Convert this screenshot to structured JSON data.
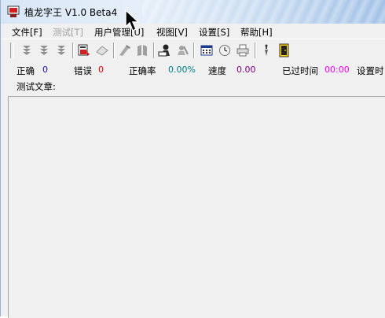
{
  "window": {
    "title": "植龙字王 V1.0 Beta4"
  },
  "menu": [
    {
      "label": "文件[F]",
      "enabled": true
    },
    {
      "label": "测试[T]",
      "enabled": false
    },
    {
      "label": "用户管理[U]",
      "enabled": true
    },
    {
      "label": "视图[V]",
      "enabled": true
    },
    {
      "label": "设置[S]",
      "enabled": true
    },
    {
      "label": "帮助[H]",
      "enabled": true
    }
  ],
  "toolbar": {
    "buttons": [
      {
        "icon": "stack-down-icon",
        "enabled": false
      },
      {
        "icon": "stack-down-icon-2",
        "enabled": false
      },
      {
        "icon": "stack-down-icon-3",
        "enabled": false
      },
      {
        "icon": "red-document-icon",
        "enabled": true
      },
      {
        "icon": "eraser-icon",
        "enabled": false
      },
      {
        "icon": "gray-tool-icon",
        "enabled": false
      },
      {
        "icon": "gray-book-icon",
        "enabled": false
      },
      {
        "icon": "user-keyboard-icon",
        "enabled": true
      },
      {
        "icon": "gray-user-icon",
        "enabled": false
      },
      {
        "icon": "calculator-icon",
        "enabled": true
      },
      {
        "icon": "clock-icon",
        "enabled": true
      },
      {
        "icon": "printer-icon",
        "enabled": true
      },
      {
        "icon": "tools-icon",
        "enabled": true
      },
      {
        "icon": "exit-door-icon",
        "enabled": true
      }
    ]
  },
  "stats": {
    "correct_label": "正确",
    "correct_value": "0",
    "error_label": "错误",
    "error_value": "0",
    "accuracy_label": "正确率",
    "accuracy_value": "0.00%",
    "speed_label": "速度",
    "speed_value": "0.00",
    "elapsed_label": "已过时间",
    "elapsed_value": "00:00",
    "set_time_label": "设置时"
  },
  "article": {
    "label": "测试文章:"
  },
  "colors": {
    "correct_value": "#1010c0",
    "error_value": "#e00000",
    "accuracy_value": "#008080",
    "speed_value": "#800080",
    "elapsed_value": "#ff00ff"
  }
}
